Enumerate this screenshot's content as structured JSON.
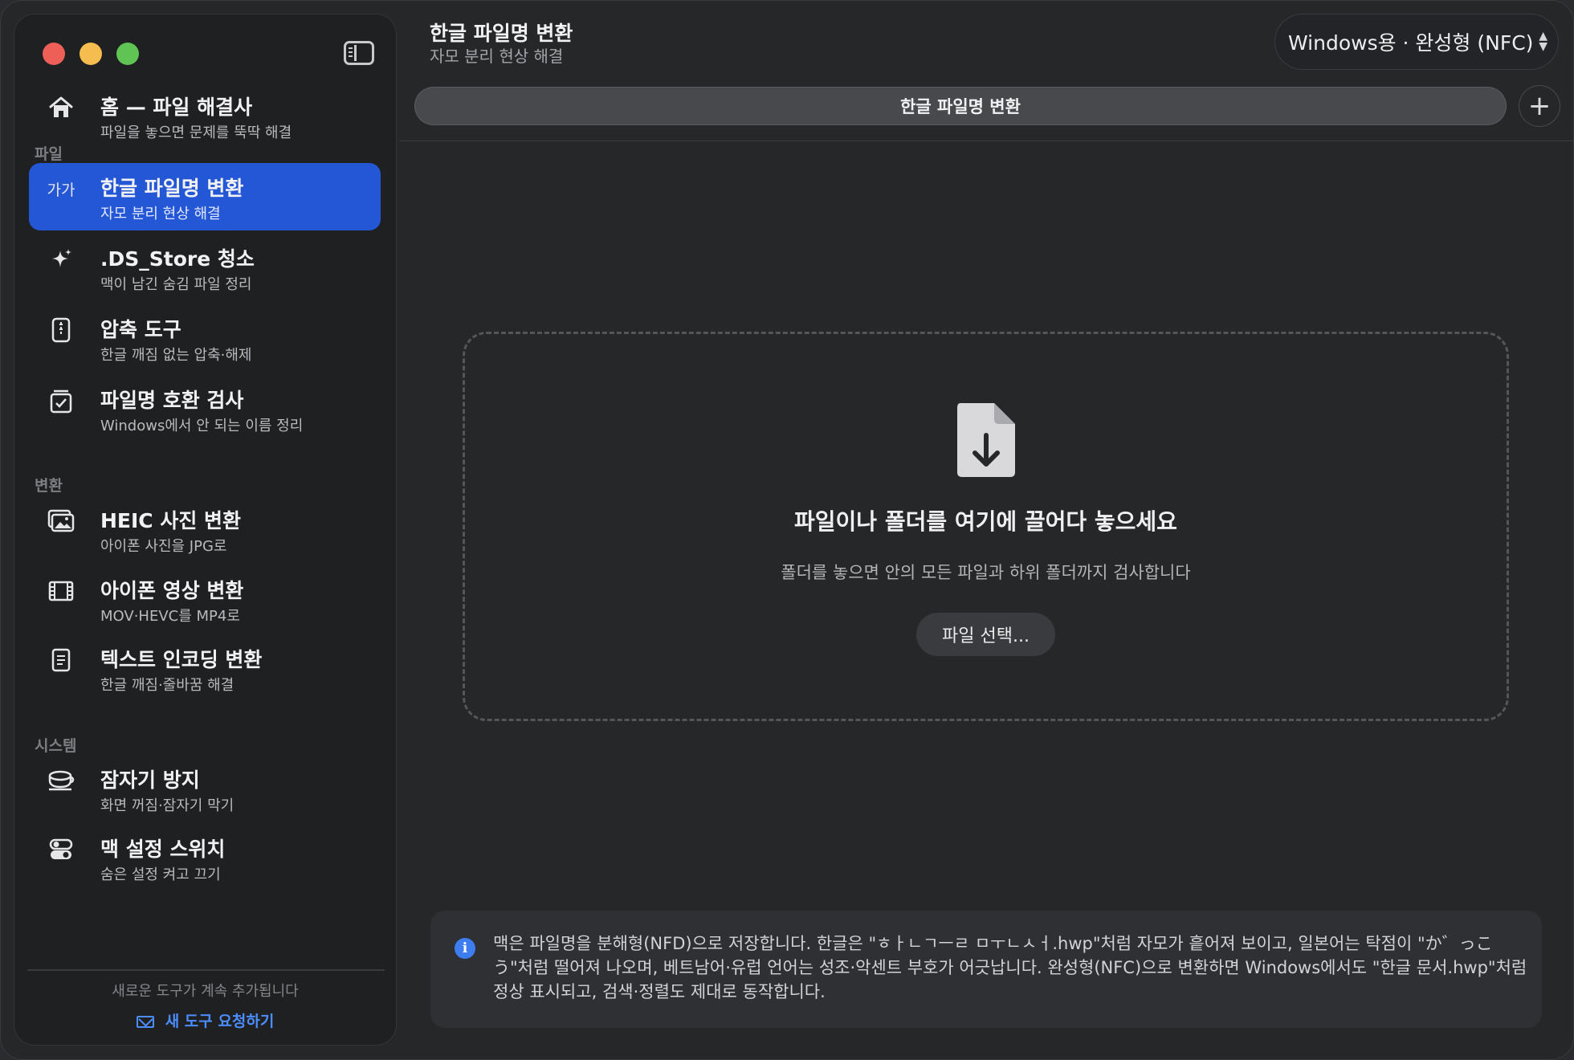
{
  "header": {
    "title": "한글 파일명 변환",
    "subtitle": "자모 분리 현상 해결",
    "mode_select": "Windows용 · 완성형 (NFC)",
    "tab_label": "한글 파일명 변환",
    "add_tab": "+"
  },
  "sidebar": {
    "home": {
      "title": "홈 — 파일 해결사",
      "sub": "파일을 놓으면 문제를 뚝딱 해결"
    },
    "sections": {
      "file": "파일",
      "convert": "변환",
      "system": "시스템"
    },
    "items": [
      {
        "title": "한글 파일명 변환",
        "sub": "자모 분리 현상 해결",
        "icon": "hangul-icon",
        "glyph": "가가"
      },
      {
        "title": ".DS_Store 청소",
        "sub": "맥이 남긴 숨김 파일 정리",
        "icon": "sparkle-icon",
        "glyph": "✦"
      },
      {
        "title": "압축 도구",
        "sub": "한글 깨짐 없는 압축·해제",
        "icon": "zip-icon",
        "glyph": ""
      },
      {
        "title": "파일명 호환 검사",
        "sub": "Windows에서 안 되는 이름 정리",
        "icon": "checklist-icon",
        "glyph": ""
      },
      {
        "title": "HEIC 사진 변환",
        "sub": "아이폰 사진을 JPG로",
        "icon": "photos-icon",
        "glyph": ""
      },
      {
        "title": "아이폰 영상 변환",
        "sub": "MOV·HEVC를 MP4로",
        "icon": "film-icon",
        "glyph": ""
      },
      {
        "title": "텍스트 인코딩 변환",
        "sub": "한글 깨짐·줄바꿈 해결",
        "icon": "document-icon",
        "glyph": ""
      },
      {
        "title": "잠자기 방지",
        "sub": "화면 꺼짐·잠자기 막기",
        "icon": "coffee-cup-icon",
        "glyph": ""
      },
      {
        "title": "맥 설정 스위치",
        "sub": "숨은 설정 켜고 끄기",
        "icon": "toggles-icon",
        "glyph": ""
      }
    ],
    "footer_note": "새로운 도구가 계속 추가됩니다",
    "footer_link": "새 도구 요청하기"
  },
  "dropzone": {
    "title": "파일이나 폴더를 여기에 끌어다 놓으세요",
    "subtitle": "폴더를 놓으면 안의 모든 파일과 하위 폴더까지 검사합니다",
    "button": "파일 선택..."
  },
  "info": {
    "text": "맥은 파일명을 분해형(NFD)으로 저장합니다. 한글은 \"ㅎㅏㄴㄱㅡㄹ ㅁㅜㄴㅅㅓ.hwp\"처럼 자모가 흩어져 보이고, 일본어는 탁점이 \"か゛っこう\"처럼 떨어져 나오며, 베트남어·유럽 언어는 성조·악센트 부호가 어긋납니다. 완성형(NFC)으로 변환하면 Windows에서도 \"한글 문서.hwp\"처럼 정상 표시되고, 검색·정렬도 제대로 동작합니다."
  },
  "colors": {
    "accent": "#2457d6",
    "link": "#4c8dff",
    "info_icon": "#3d7df0"
  }
}
